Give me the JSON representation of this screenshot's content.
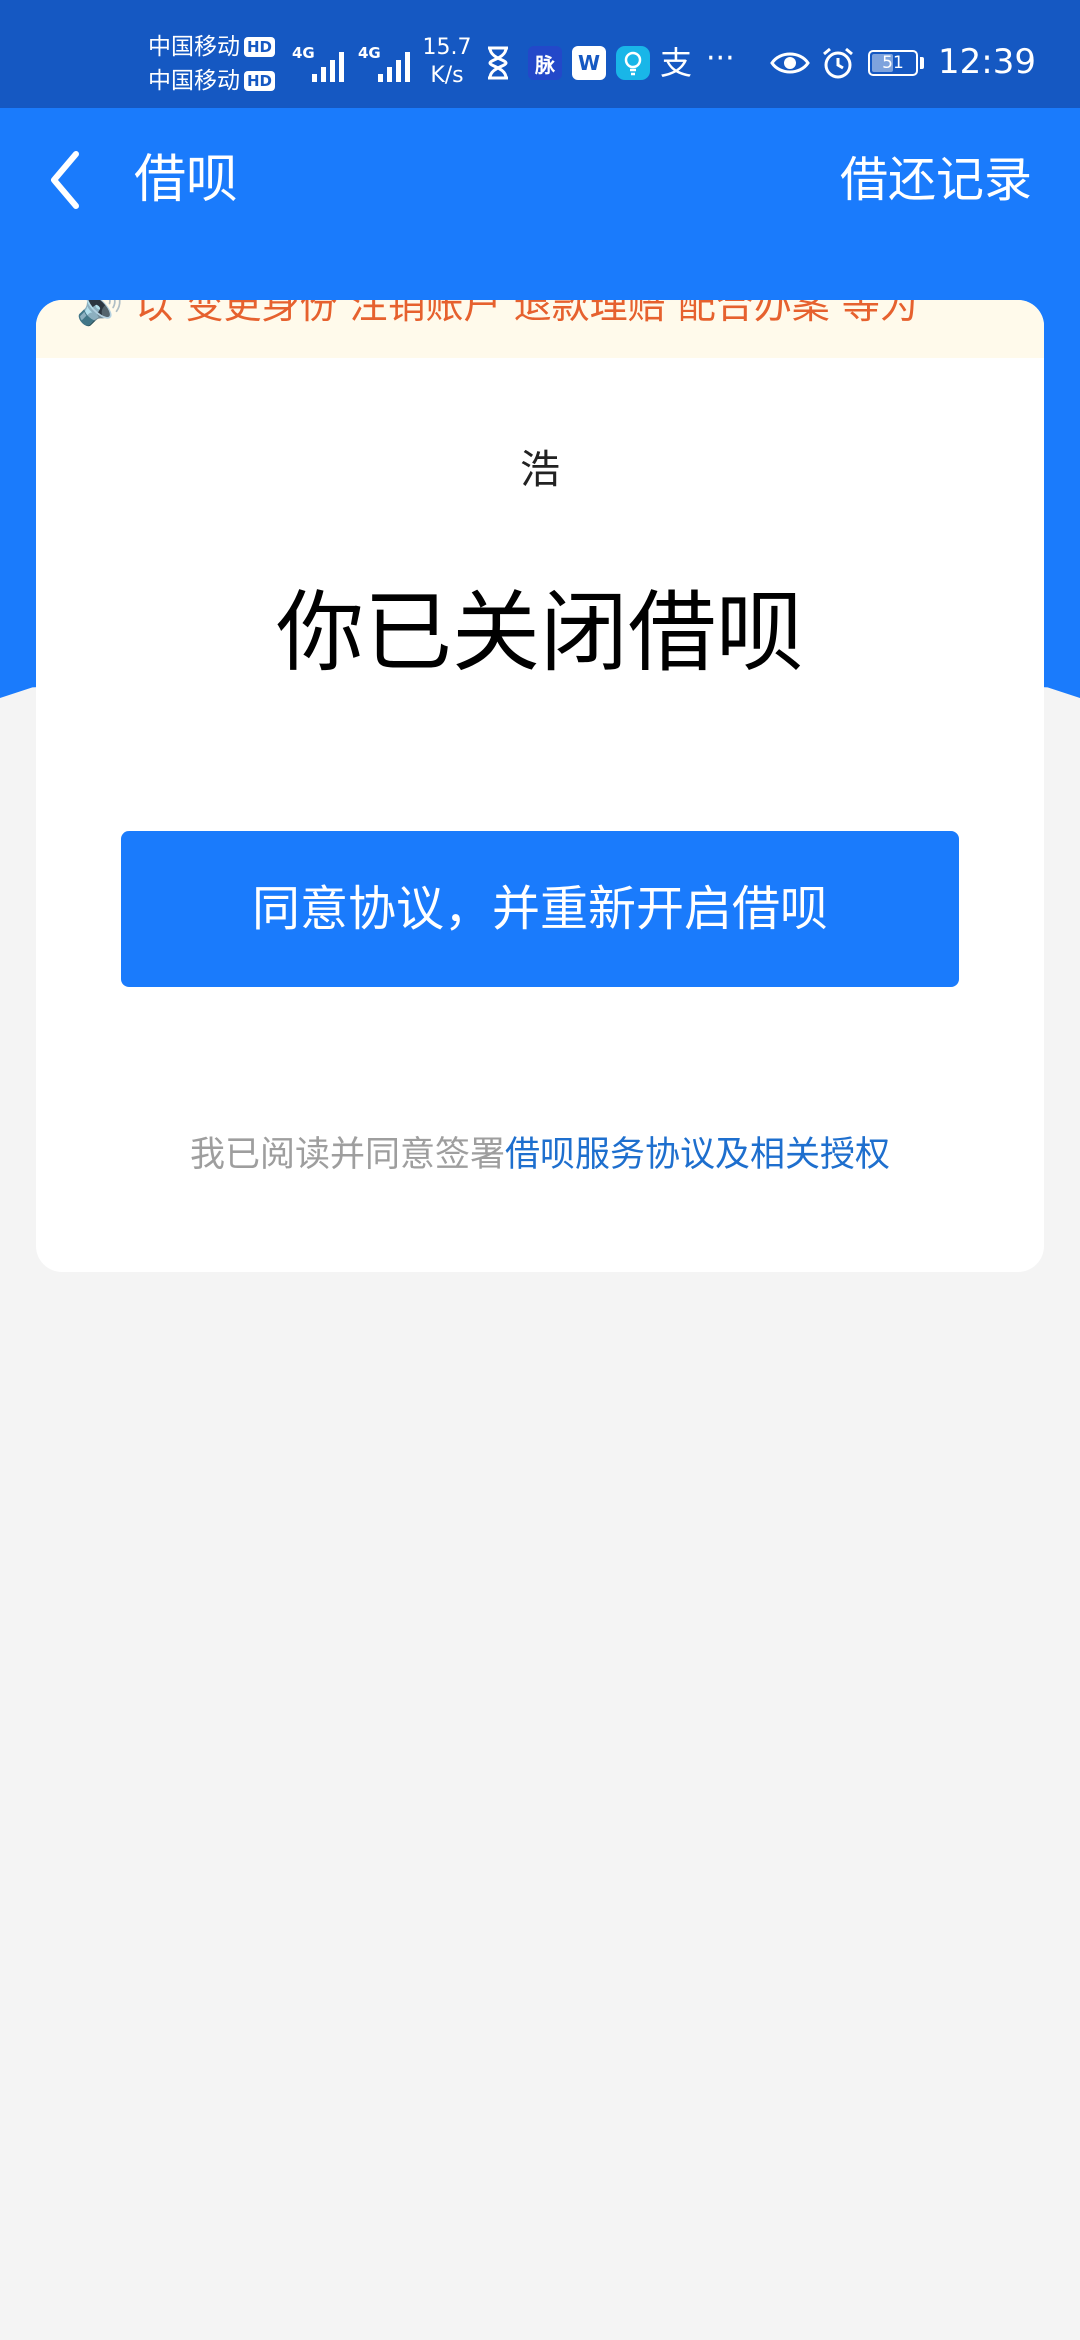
{
  "status_bar": {
    "carrier_1": "中国移动",
    "carrier_2": "中国移动",
    "hd_label": "HD",
    "net_type_1": "4G",
    "net_type_2": "4G",
    "speed_value": "15.7",
    "speed_unit": "K/s",
    "app_icons": [
      "hourglass-icon",
      "mai-app-icon",
      "wps-app-icon",
      "bulb-app-icon",
      "alipay-icon"
    ],
    "app_tile_mai": "脉",
    "app_tile_wps": "W",
    "app_tile_alipay": "支",
    "more_label": "···",
    "battery_level": 51,
    "battery_label": "51",
    "time": "12:39"
  },
  "nav": {
    "title": "借呗",
    "action": "借还记录"
  },
  "notice": {
    "text": "🔊 以 变更身份  注销账户  退款理赔  配合办案 等为"
  },
  "main": {
    "user_name": "浩",
    "status_title": "你已关闭借呗",
    "button_label": "同意协议，并重新开启借呗",
    "agreement_prefix": "我已阅读并同意签署",
    "agreement_link": "借呗服务协议及相关授权"
  },
  "colors": {
    "status_bar_bg": "#1558c2",
    "header_blue": "#1a7bfc",
    "page_bg": "#f4f4f4",
    "notice_bg": "#fffaeb",
    "notice_text": "#e6612e",
    "link_blue": "#1e6fce",
    "muted_gray": "#9e9e9e"
  }
}
